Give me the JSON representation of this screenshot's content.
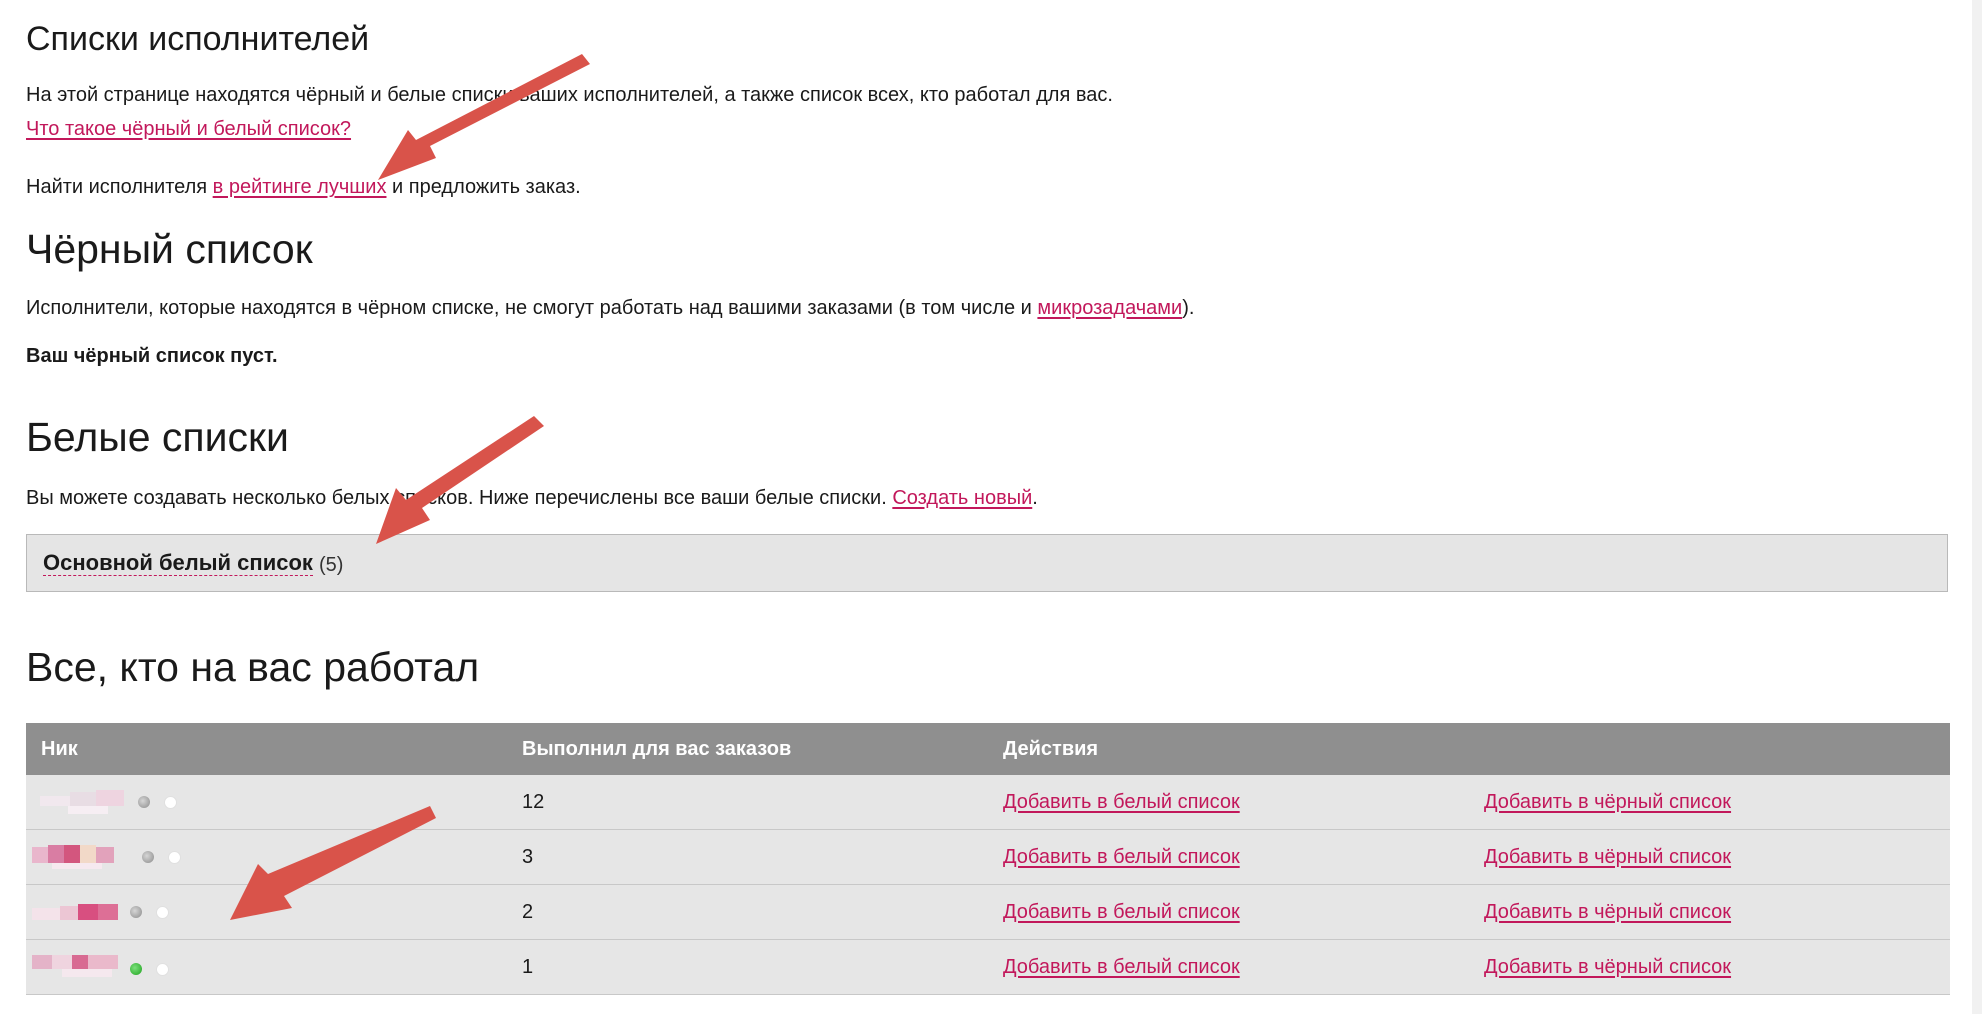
{
  "page": {
    "title": "Списки исполнителей",
    "intro": "На этой странице находятся чёрный и белые списки ваших исполнителей, а также список всех, кто работал для вас.",
    "intro_link": "Что такое чёрный и белый список?",
    "find_prefix": "Найти исполнителя ",
    "find_link": "в рейтинге лучших",
    "find_suffix": " и предложить заказ."
  },
  "blacklist": {
    "heading": "Чёрный список",
    "desc_prefix": "Исполнители, которые находятся в чёрном списке, не смогут работать над вашими заказами (в том числе и ",
    "desc_link": "микрозадачами",
    "desc_suffix": ").",
    "empty": "Ваш чёрный список пуст."
  },
  "whitelists": {
    "heading": "Белые списки",
    "desc": "Вы можете создавать несколько белых списков. Ниже перечислены все ваши белые списки. ",
    "create_link": "Создать новый",
    "create_suffix": ".",
    "main_name": "Основной белый список",
    "main_count": "(5)"
  },
  "workers": {
    "heading": "Все, кто на вас работал",
    "columns": [
      "Ник",
      "Выполнил для вас заказов",
      "Действия"
    ],
    "rows": [
      {
        "orders": "12",
        "status": "gray",
        "add_white": "Добавить в белый список",
        "add_black": "Добавить в чёрный список"
      },
      {
        "orders": "3",
        "status": "gray",
        "add_white": "Добавить в белый список",
        "add_black": "Добавить в чёрный список"
      },
      {
        "orders": "2",
        "status": "gray",
        "add_white": "Добавить в белый список",
        "add_black": "Добавить в чёрный список"
      },
      {
        "orders": "1",
        "status": "green",
        "add_white": "Добавить в белый список",
        "add_black": "Добавить в чёрный список"
      }
    ]
  },
  "colors": {
    "link": "#c2185b",
    "table_header": "#8f8f8f",
    "row_bg": "#e6e6e6",
    "annotation_arrow": "#d9534a",
    "status_online": "#1fa31f",
    "status_offline": "#8a8a8a"
  }
}
